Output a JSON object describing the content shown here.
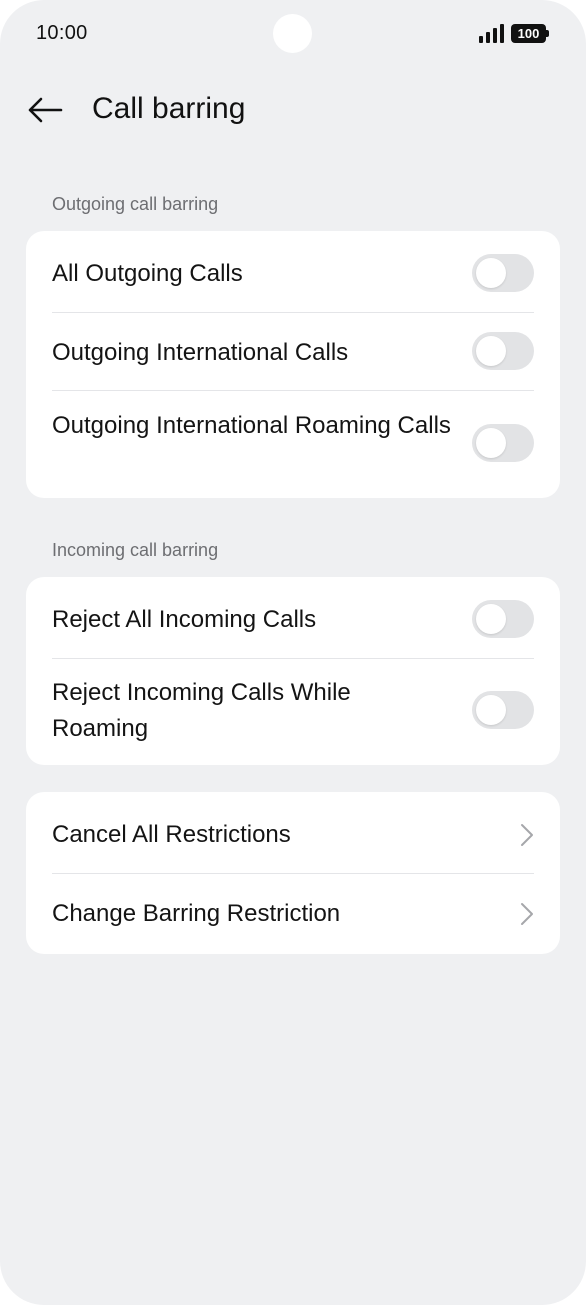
{
  "status_bar": {
    "time": "10:00",
    "battery_level": "100",
    "signal_icon": "cellular-signal-icon",
    "battery_icon": "battery-icon"
  },
  "header": {
    "back_icon": "arrow-left-icon",
    "title": "Call barring"
  },
  "outgoing_section": {
    "header": "Outgoing call barring",
    "items": [
      {
        "label": "All Outgoing Calls",
        "enabled": false
      },
      {
        "label": "Outgoing International Calls",
        "enabled": false
      },
      {
        "label": "Outgoing International Roaming Calls",
        "enabled": false
      }
    ]
  },
  "incoming_section": {
    "header": "Incoming call barring",
    "items": [
      {
        "label": "Reject All Incoming Calls",
        "enabled": false
      },
      {
        "label": "Reject Incoming Calls While Roaming",
        "enabled": false
      }
    ]
  },
  "actions_section": {
    "items": [
      {
        "label": "Cancel All Restrictions",
        "icon": "chevron-right-icon"
      },
      {
        "label": "Change Barring Restriction",
        "icon": "chevron-right-icon"
      }
    ]
  },
  "colors": {
    "background": "#eff0f2",
    "card": "#ffffff",
    "toggle_off_track": "#e2e3e5",
    "section_header_text": "#6d6e72",
    "primary_text": "#141414"
  }
}
